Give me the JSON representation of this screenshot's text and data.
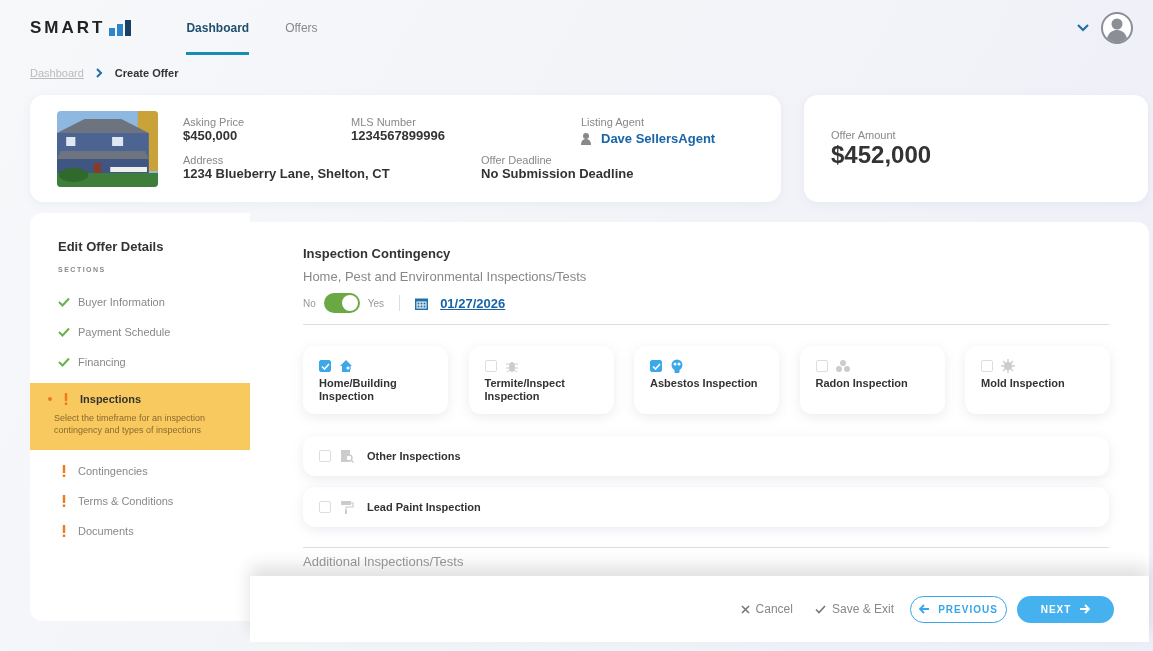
{
  "header": {
    "logo": {
      "text": "SMART"
    },
    "nav": [
      {
        "label": "Dashboard",
        "selected": true
      },
      {
        "label": "Offers",
        "selected": false
      }
    ]
  },
  "breadcrumb": [
    {
      "label": "Dashboard",
      "kind": "link"
    },
    {
      "label": "Create Offer",
      "kind": "current"
    }
  ],
  "property": {
    "fields": [
      {
        "label": "Asking Price",
        "value": "$450,000"
      },
      {
        "label": "MLS Number",
        "value": "1234567899996"
      },
      {
        "label": "Listing Agent",
        "value": "Dave SellersAgent",
        "kind": "agent"
      },
      {
        "label": "Address",
        "value": "1234 Blueberry Lane, Shelton, CT"
      },
      {
        "label": "Offer Deadline",
        "value": "No Submission Deadline"
      }
    ]
  },
  "offer": {
    "label": "Offer Amount",
    "value": "$452,000"
  },
  "sidebar": {
    "title": "Edit Offer Details",
    "subtitle": "SECTIONS",
    "items": [
      {
        "label": "Buyer Information",
        "kind": "done",
        "selected": false
      },
      {
        "label": "Payment Schedule",
        "kind": "done",
        "selected": false
      },
      {
        "label": "Financing",
        "kind": "done",
        "selected": false
      },
      {
        "label": "Inspections",
        "kind": "todo",
        "selected": true,
        "description": "Select the timeframe for an inspection contingency and types of inspections"
      },
      {
        "label": "Contingencies",
        "kind": "todo",
        "selected": false
      },
      {
        "label": "Terms & Conditions",
        "kind": "todo",
        "selected": false
      },
      {
        "label": "Documents",
        "kind": "todo",
        "selected": false
      }
    ]
  },
  "main": {
    "title": "Inspection Contingency",
    "subtitle": "Home, Pest and Environmental Inspections/Tests",
    "toggle": {
      "off_label": "No",
      "on_label": "Yes",
      "on": true
    },
    "date": "01/27/2026",
    "cards": [
      {
        "label": "Home/Building Inspection",
        "kind": "house",
        "checked": true
      },
      {
        "label": "Termite/Inspect Inspection",
        "kind": "bug",
        "checked": false
      },
      {
        "label": "Asbestos Inspection",
        "kind": "mask",
        "checked": true
      },
      {
        "label": "Radon Inspection",
        "kind": "radon",
        "checked": false
      },
      {
        "label": "Mold Inspection",
        "kind": "mold",
        "checked": false
      }
    ],
    "rows": [
      {
        "label": "Other Inspections",
        "kind": "search",
        "checked": false
      },
      {
        "label": "Lead Paint Inspection",
        "kind": "paint",
        "checked": false
      }
    ],
    "next_section": "Additional Inspections/Tests"
  },
  "footer": {
    "cancel": "Cancel",
    "save": "Save & Exit",
    "previous": "PREVIOUS",
    "next": "NEXT"
  }
}
